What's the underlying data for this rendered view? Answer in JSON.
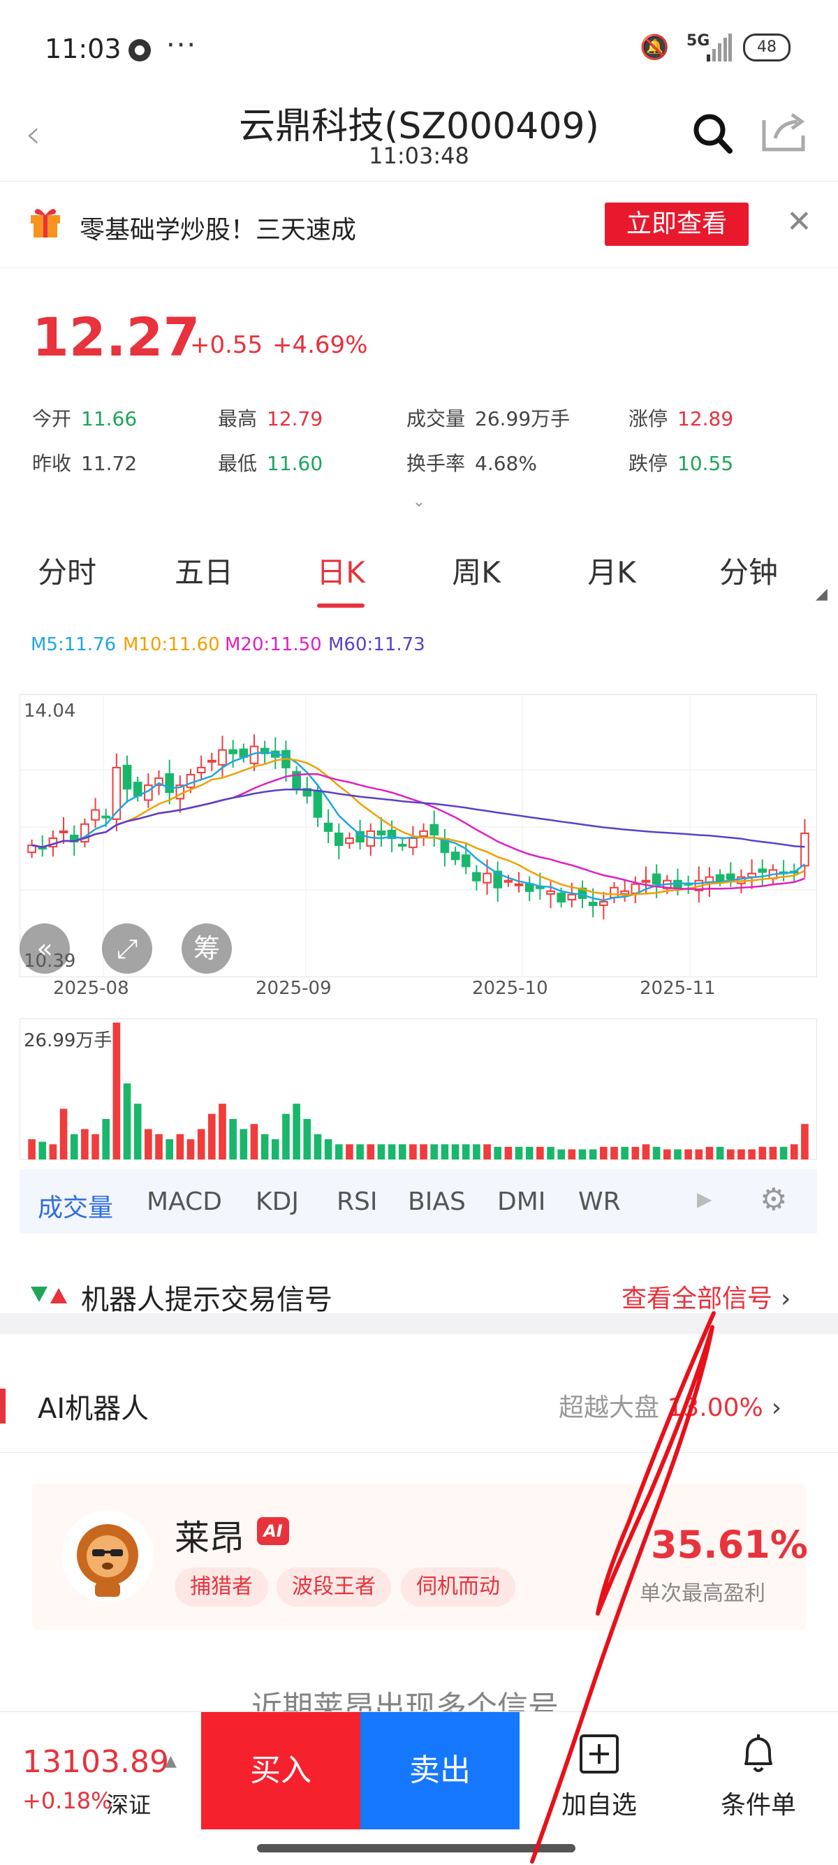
{
  "status_bar": {
    "time": "11:03",
    "dots": "···",
    "network": "5G",
    "battery": "48"
  },
  "header": {
    "title": "云鼎科技(SZ000409)",
    "subtitle": "11:03:48"
  },
  "promo": {
    "text": "零基础学炒股！三天速成",
    "button": "立即查看"
  },
  "quote": {
    "price": "12.27",
    "change": "+0.55",
    "change_pct": "+4.69%",
    "stats": [
      {
        "label": "今开",
        "value": "11.66",
        "color": "green"
      },
      {
        "label": "最高",
        "value": "12.79",
        "color": "red"
      },
      {
        "label": "成交量",
        "value": "26.99万手",
        "color": "plain"
      },
      {
        "label": "涨停",
        "value": "12.89",
        "color": "red"
      },
      {
        "label": "昨收",
        "value": "11.72",
        "color": "plain"
      },
      {
        "label": "最低",
        "value": "11.60",
        "color": "green"
      },
      {
        "label": "换手率",
        "value": "4.68%",
        "color": "plain"
      },
      {
        "label": "跌停",
        "value": "10.55",
        "color": "green"
      }
    ]
  },
  "tabs": [
    "分时",
    "五日",
    "日K",
    "周K",
    "月K",
    "分钟"
  ],
  "active_tab": "日K",
  "ma": [
    {
      "label": "M5:11.76",
      "color": "#1fa6e0"
    },
    {
      "label": "M10:11.60",
      "color": "#f0a000"
    },
    {
      "label": "M20:11.50",
      "color": "#e020c0"
    },
    {
      "label": "M60:11.73",
      "color": "#5a40c8"
    }
  ],
  "chart_data": {
    "type": "candlestick",
    "price_axis": {
      "top_label": "14.04",
      "bottom_label": "10.39",
      "ylim": [
        10.39,
        14.04
      ]
    },
    "x_ticks": [
      "2025-08",
      "2025-09",
      "2025-10",
      "2025-11"
    ],
    "close": [
      12.1,
      12.05,
      12.2,
      12.3,
      12.15,
      12.4,
      12.6,
      12.5,
      13.2,
      12.9,
      12.8,
      12.95,
      13.05,
      12.85,
      12.95,
      13.1,
      13.2,
      13.3,
      13.45,
      13.4,
      13.35,
      13.5,
      13.4,
      13.35,
      13.2,
      12.9,
      12.8,
      12.5,
      12.3,
      12.1,
      12.2,
      12.15,
      12.3,
      12.25,
      12.2,
      12.1,
      12.2,
      12.3,
      12.25,
      12.0,
      11.9,
      11.8,
      11.6,
      11.7,
      11.5,
      11.6,
      11.55,
      11.45,
      11.5,
      11.45,
      11.3,
      11.4,
      11.35,
      11.25,
      11.3,
      11.5,
      11.45,
      11.55,
      11.6,
      11.55,
      11.6,
      11.5,
      11.55,
      11.6,
      11.65,
      11.6,
      11.62,
      11.65,
      11.7,
      11.72,
      11.75,
      11.7,
      11.72,
      12.27
    ],
    "volume_label": "26.99万手",
    "volume": [
      4,
      3.5,
      3,
      10,
      5,
      6,
      5,
      8,
      26.99,
      15,
      11,
      6,
      5,
      4,
      5,
      4,
      6,
      9,
      11,
      8,
      6,
      7,
      5,
      4,
      9,
      11,
      8,
      5,
      4,
      3,
      3,
      3,
      3,
      3,
      3,
      3,
      3,
      3,
      3,
      3,
      3,
      3,
      3,
      3,
      2.5,
      2.5,
      2.5,
      2.5,
      2.5,
      2.5,
      2,
      2,
      2,
      2,
      2.5,
      2.5,
      2.5,
      2.5,
      3,
      2.5,
      2,
      2,
      2,
      2,
      2.5,
      2.5,
      2,
      2,
      2,
      2.5,
      2.5,
      2.5,
      3,
      7
    ]
  },
  "indicators": [
    "成交量",
    "MACD",
    "KDJ",
    "RSI",
    "BIAS",
    "DMI",
    "WR"
  ],
  "active_indicator": "成交量",
  "chart_buttons": {
    "chip": "筹"
  },
  "signals": {
    "title": "机器人提示交易信号",
    "link": "查看全部信号"
  },
  "ai": {
    "title": "AI机器人",
    "right_text": "超越大盘",
    "right_value": "13.00%"
  },
  "robot": {
    "name": "莱昂",
    "badge": "AI",
    "tags": [
      "捕猎者",
      "波段王者",
      "伺机而动"
    ],
    "pct": "35.61%",
    "pct_label": "单次最高盈利"
  },
  "teaser": "近期莱昂出现多个信号",
  "bottom": {
    "index_value": "13103.89",
    "index_change": "+0.18%",
    "index_name": "深证",
    "buy": "买入",
    "sell": "卖出",
    "watch": "加自选",
    "alert": "条件单"
  }
}
